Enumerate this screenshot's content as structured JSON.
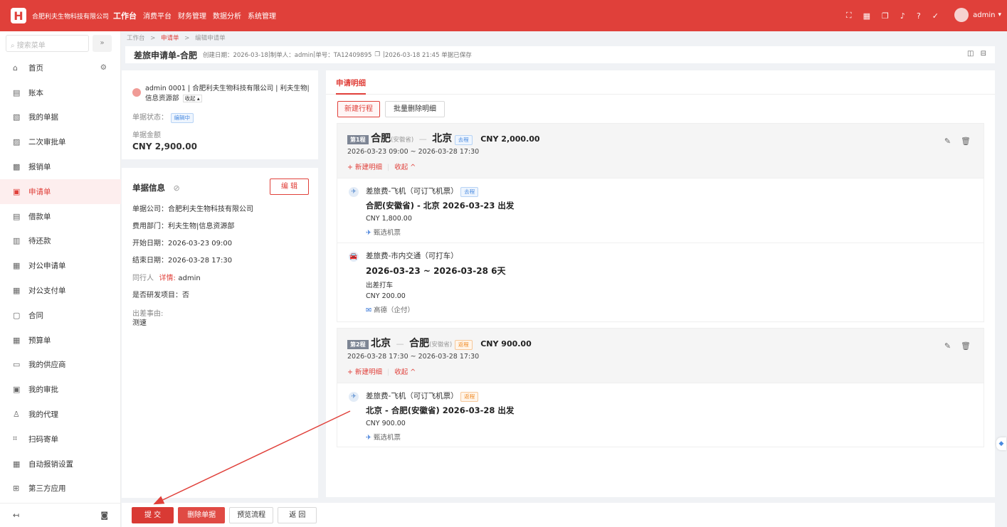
{
  "topbar": {
    "logo": "H",
    "company": "合肥利夫生物科技有限公司",
    "nav": [
      "工作台",
      "消费平台",
      "财务管理",
      "数据分析",
      "系统管理"
    ],
    "user": "admin"
  },
  "sidebar": {
    "search_placeholder": "搜索菜单",
    "collapse": "»",
    "items": [
      {
        "label": "首页",
        "icon": "home-icon"
      },
      {
        "label": "账本",
        "icon": "ledger-icon"
      },
      {
        "label": "我的单据",
        "icon": "docs-icon"
      },
      {
        "label": "二次审批单",
        "icon": "approval-icon"
      },
      {
        "label": "报销单",
        "icon": "reimburse-icon"
      },
      {
        "label": "申请单",
        "icon": "apply-icon"
      },
      {
        "label": "借款单",
        "icon": "loan-icon"
      },
      {
        "label": "待还款",
        "icon": "repay-icon"
      },
      {
        "label": "对公申请单",
        "icon": "corp-apply-icon"
      },
      {
        "label": "对公支付单",
        "icon": "corp-pay-icon"
      },
      {
        "label": "合同",
        "icon": "contract-icon"
      },
      {
        "label": "预算单",
        "icon": "budget-icon"
      },
      {
        "label": "我的供应商",
        "icon": "supplier-icon"
      },
      {
        "label": "我的审批",
        "icon": "my-approval-icon"
      },
      {
        "label": "我的代理",
        "icon": "agent-icon"
      },
      {
        "label": "扫码寄单",
        "icon": "scan-icon"
      },
      {
        "label": "自动报销设置",
        "icon": "auto-icon"
      },
      {
        "label": "第三方应用",
        "icon": "apps-icon"
      }
    ],
    "active_index": 5
  },
  "breadcrumb": {
    "home": "工作台",
    "sep": ">",
    "list": "申请单",
    "current": "编辑申请单"
  },
  "header": {
    "title": "差旅申请单-合肥",
    "created": "创建日期：2026-03-18",
    "creator": "制单人：admin",
    "doc_no": "单号：TA12409895",
    "saved": "2026-03-18 21:45 单据已保存"
  },
  "summary": {
    "user_line": "admin 0001 | 合肥利夫生物科技有限公司 | 利夫生物|",
    "dept_line": "信息资源部",
    "collapse": "收起 ▴",
    "status_label": "单据状态：",
    "status": "编辑中",
    "amount_label": "单据金额",
    "amount": "CNY 2,900.00"
  },
  "info": {
    "title": "单据信息",
    "edit": "编 辑",
    "rows": [
      "单据公司：合肥利夫生物科技有限公司",
      "费用部门：利夫生物|信息资源部",
      "开始日期：2026-03-23 09:00",
      "结束日期：2026-03-28 17:30"
    ],
    "companion_label": "同行人",
    "companion_link": "详情:",
    "companion": "admin",
    "rd": "是否研发项目：否",
    "reason_label": "出差事由:",
    "reason": "测速"
  },
  "detail": {
    "tab": "申请明细",
    "new_trip": "新建行程",
    "batch_delete": "批量删除明细",
    "segments": [
      {
        "tag": "第1程",
        "from": "合肥",
        "from_prov": "(安徽省)",
        "to": "北京",
        "to_prov": "",
        "dir": "去程",
        "amount": "CNY 2,000.00",
        "dates": "2026-03-23 09:00 ~ 2026-03-28 17:30",
        "add": "+ 新建明细",
        "fold": "收起 ^",
        "items": [
          {
            "title": "差旅费-飞机（可订飞机票）",
            "badge": "去程",
            "main": "合肥(安徽省) - 北京   2026-03-23 出发",
            "sub": "",
            "amount": "CNY 1,800.00",
            "vendor": "甄选机票"
          },
          {
            "title": "差旅费-市内交通（可打车）",
            "badge": "",
            "main": "2026-03-23 ~ 2026-03-28 6天",
            "sub": "出差打车",
            "amount": "CNY 200.00",
            "vendor": "高德（企付）"
          }
        ]
      },
      {
        "tag": "第2程",
        "from": "北京",
        "from_prov": "",
        "to": "合肥",
        "to_prov": "(安徽省)",
        "dir": "返程",
        "amount": "CNY 900.00",
        "dates": "2026-03-28 17:30 ~ 2026-03-28 17:30",
        "add": "+ 新建明细",
        "fold": "收起 ^",
        "items": [
          {
            "title": "差旅费-飞机（可订飞机票）",
            "badge": "返程",
            "main": "北京 - 合肥(安徽省)   2026-03-28 出发",
            "sub": "",
            "amount": "CNY 900.00",
            "vendor": "甄选机票"
          }
        ]
      }
    ]
  },
  "footer": {
    "submit": "提 交",
    "delete": "删除单据",
    "preview": "预览流程",
    "back": "返 回"
  },
  "colors": {
    "brand": "#e0403a",
    "arrow": "#e0403a"
  }
}
